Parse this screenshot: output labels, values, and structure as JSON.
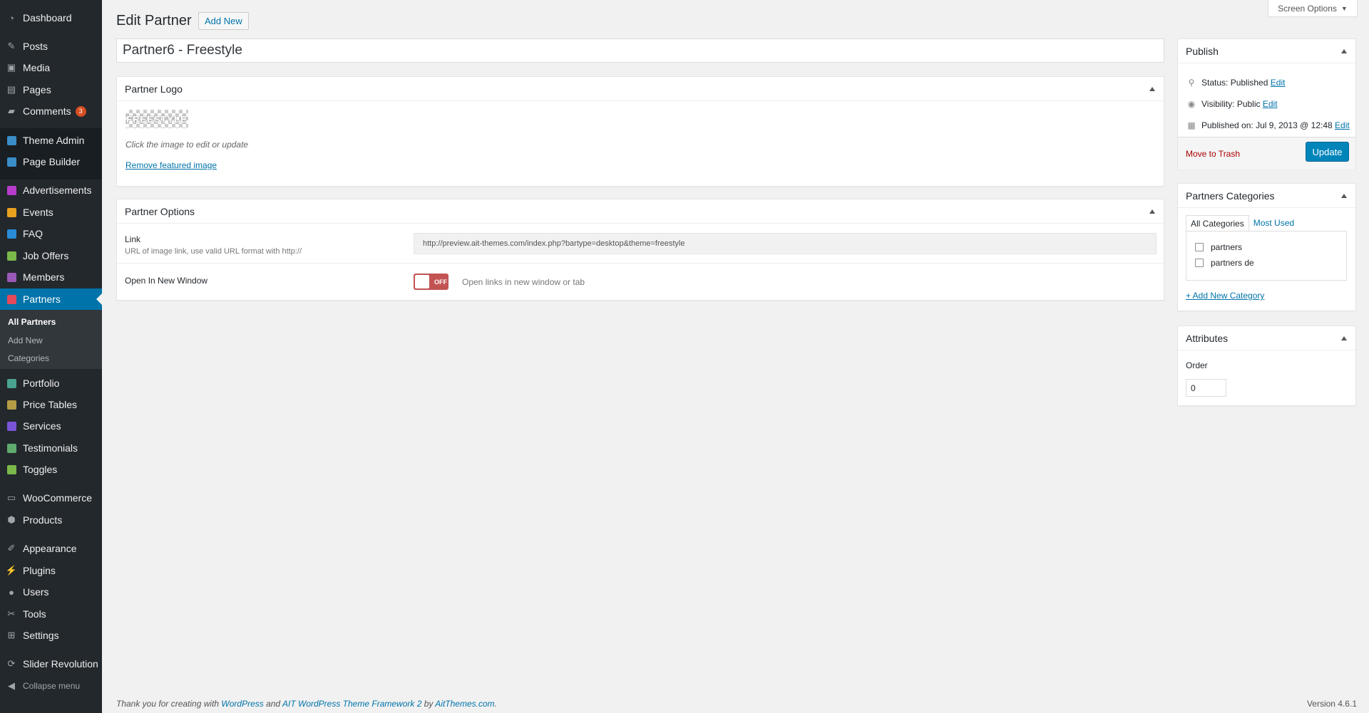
{
  "sidebar": {
    "items": [
      {
        "label": "Dashboard",
        "icon": "dashboard-icon"
      },
      {
        "label": "Posts",
        "icon": "pin-icon"
      },
      {
        "label": "Media",
        "icon": "media-icon"
      },
      {
        "label": "Pages",
        "icon": "pages-icon"
      },
      {
        "label": "Comments",
        "icon": "comments-icon",
        "badge": "3"
      },
      {
        "label": "Theme Admin",
        "icon": "ait-icon"
      },
      {
        "label": "Page Builder",
        "icon": "ait-icon"
      },
      {
        "label": "Advertisements",
        "icon": "advertisements-icon",
        "color": "#b63dcb"
      },
      {
        "label": "Events",
        "icon": "events-icon",
        "color": "#e8a21e"
      },
      {
        "label": "FAQ",
        "icon": "faq-icon",
        "color": "#2a8bd6"
      },
      {
        "label": "Job Offers",
        "icon": "job-offers-icon",
        "color": "#7bb84a"
      },
      {
        "label": "Members",
        "icon": "members-icon",
        "color": "#9b59b6"
      },
      {
        "label": "Partners",
        "icon": "partners-icon",
        "color": "#e5495a"
      },
      {
        "label": "Portfolio",
        "icon": "portfolio-icon",
        "color": "#4aa38e"
      },
      {
        "label": "Price Tables",
        "icon": "price-tables-icon",
        "color": "#b59b45"
      },
      {
        "label": "Services",
        "icon": "services-icon",
        "color": "#7a54d6"
      },
      {
        "label": "Testimonials",
        "icon": "testimonials-icon",
        "color": "#5fab6e"
      },
      {
        "label": "Toggles",
        "icon": "toggles-icon",
        "color": "#7bb84a"
      },
      {
        "label": "WooCommerce",
        "icon": "woocommerce-icon"
      },
      {
        "label": "Products",
        "icon": "products-icon"
      },
      {
        "label": "Appearance",
        "icon": "brush-icon"
      },
      {
        "label": "Plugins",
        "icon": "plugin-icon"
      },
      {
        "label": "Users",
        "icon": "user-icon"
      },
      {
        "label": "Tools",
        "icon": "wrench-icon"
      },
      {
        "label": "Settings",
        "icon": "settings-icon"
      },
      {
        "label": "Slider Revolution",
        "icon": "refresh-icon"
      }
    ],
    "submenu": [
      "All Partners",
      "Add New",
      "Categories"
    ],
    "collapse": "Collapse menu"
  },
  "header": {
    "screen_options": "Screen Options",
    "page_title": "Edit Partner",
    "add_new": "Add New",
    "post_title": "Partner6 - Freestyle"
  },
  "logo_box": {
    "title": "Partner Logo",
    "image_text": "FREESTYLE",
    "hint": "Click the image to edit or update",
    "remove": "Remove featured image"
  },
  "options_box": {
    "title": "Partner Options",
    "link_label": "Link",
    "link_desc": "URL of image link, use valid URL format with http://",
    "link_value": "http://preview.ait-themes.com/index.php?bartype=desktop&theme=freestyle",
    "window_label": "Open In New Window",
    "switch_text": "OFF",
    "window_desc": "Open links in new window or tab"
  },
  "publish": {
    "title": "Publish",
    "status_label": "Status: ",
    "status_value": "Published",
    "visibility_label": "Visibility: ",
    "visibility_value": "Public",
    "published_label": "Published on: ",
    "published_value": "Jul 9, 2013 @ 12:48",
    "edit": "Edit",
    "trash": "Move to Trash",
    "update": "Update"
  },
  "categories": {
    "title": "Partners Categories",
    "tab_all": "All Categories",
    "tab_most": "Most Used",
    "items": [
      "partners",
      "partners de"
    ],
    "add_new": "+ Add New Category"
  },
  "attributes": {
    "title": "Attributes",
    "order_label": "Order",
    "order_value": "0"
  },
  "footer": {
    "thanks_prefix": "Thank you for creating with ",
    "wordpress": "WordPress",
    "and": " and ",
    "framework": "AIT WordPress Theme Framework 2",
    "by": " by ",
    "aitthemes": "AitThemes.com",
    "period": ".",
    "version": "Version 4.6.1"
  }
}
